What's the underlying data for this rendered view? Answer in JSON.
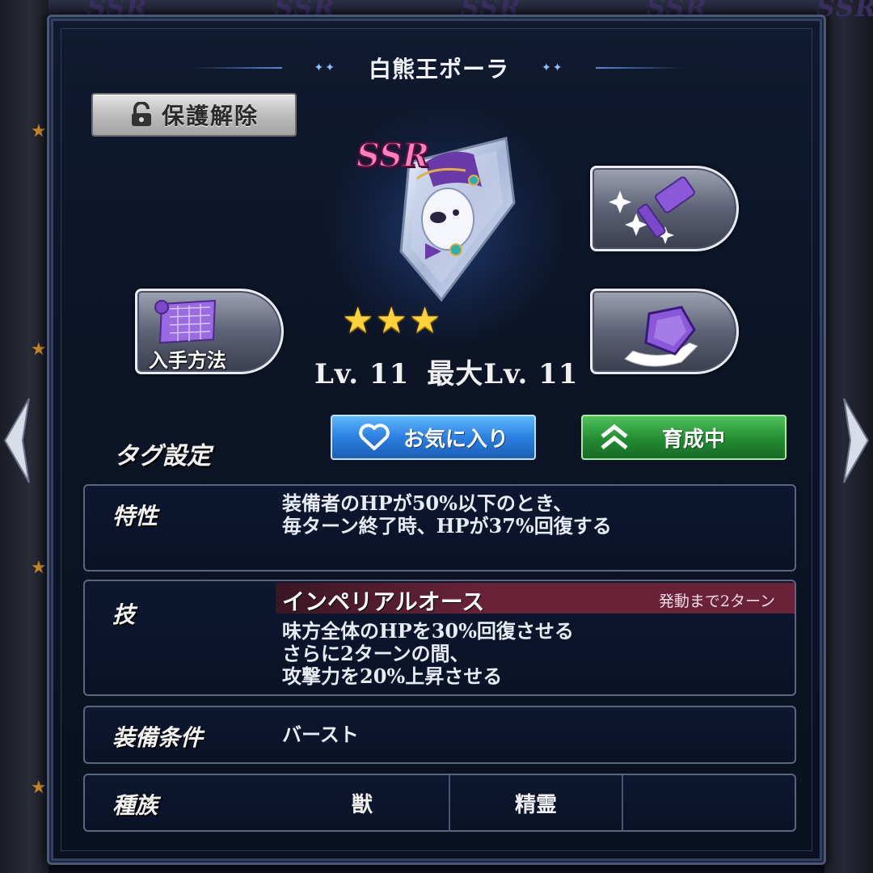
{
  "background": {
    "ssr_watermarks": [
      "SSR",
      "SSR",
      "SSR",
      "SSR",
      "SSR"
    ]
  },
  "dialog": {
    "title": "白熊王ポーラ",
    "unlock_button": "保護解除",
    "item": {
      "rarity": "SSR",
      "stars": 3,
      "level_label": "Lv. 11",
      "max_level_label": "最大Lv. 11"
    },
    "side_buttons": {
      "source_caption": "入手方法"
    },
    "tags": {
      "label": "タグ設定",
      "favorite_button": "お気に入り",
      "training_button": "育成中"
    },
    "trait": {
      "label": "特性",
      "lines": [
        "装備者のHPが50%以下のとき、",
        "毎ターン終了時、HPが37%回復する"
      ]
    },
    "skill": {
      "label": "技",
      "name": "インペリアルオース",
      "cooldown": "発動まで2ターン",
      "lines": [
        "味方全体のHPを30%回復させる",
        "さらに2ターンの間、",
        "攻撃力を20%上昇させる"
      ]
    },
    "condition": {
      "label": "装備条件",
      "value": "バースト"
    },
    "race": {
      "label": "種族",
      "values": [
        "獣",
        "精霊",
        ""
      ]
    }
  },
  "colors": {
    "ssr_pink": "#ff7fc0",
    "star_gold": "#ffd23a",
    "favorite_blue": "#2b7fe0",
    "training_green": "#238c32",
    "skill_bar": "#6a2238"
  },
  "icons": {
    "lock": "unlock-icon",
    "enhance": "hammer-sparkle-icon",
    "evolve": "gem-hand-icon",
    "source": "map-scroll-icon",
    "favorite": "heart-icon",
    "training": "double-chevron-up-icon"
  }
}
